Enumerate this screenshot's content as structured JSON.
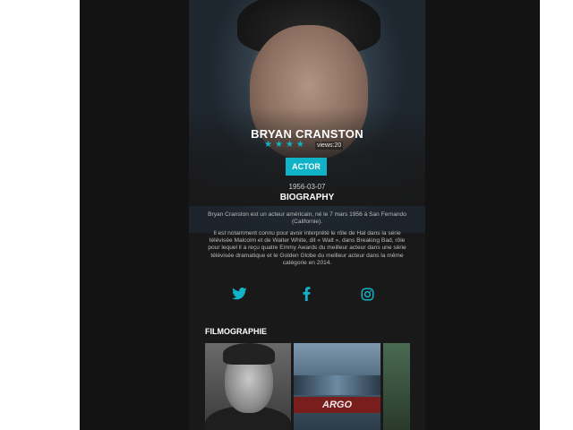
{
  "actor": {
    "name": "BRYAN CRANSTON",
    "rating_stars": 4,
    "views_label": "views:20",
    "role_label": "ACTOR",
    "birth_date": "1956-03-07"
  },
  "biography": {
    "title": "BIOGRAPHY",
    "paragraphs": [
      "Bryan Cranston est un acteur américain, né le 7 mars 1956 à San Fernando (Californie).",
      "Il est notamment connu pour avoir interprété le rôle de Hal dans la série télévisée Malcolm et de Walter White, dit « Walt », dans Breaking Bad, rôle pour lequel il a reçu quatre Emmy Awards du meilleur acteur dans une série télévisée dramatique et le Golden Globe du meilleur acteur dans la même catégorie en 2014."
    ]
  },
  "social": {
    "icons": [
      "twitter-icon",
      "facebook-icon",
      "instagram-icon"
    ],
    "accent_color": "#11b3c8"
  },
  "filmography": {
    "title": "FILMOGRAPHIE",
    "posters": [
      {
        "caption": ""
      },
      {
        "caption": "ARGO"
      },
      {
        "caption": ""
      }
    ]
  },
  "colors": {
    "accent": "#0fb2c7",
    "background": "#191919",
    "outer_frame": "#131313"
  }
}
